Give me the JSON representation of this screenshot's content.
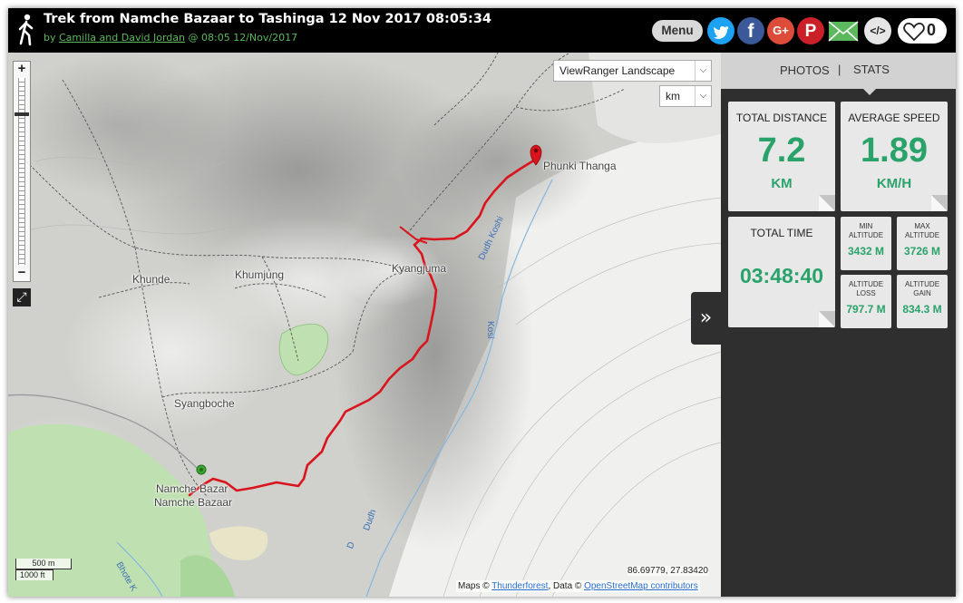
{
  "header": {
    "title": "Trek from Namche Bazaar to Tashinga 12 Nov 2017 08:05:34",
    "by_prefix": "by ",
    "author": "Camilla and David Jordan",
    "time_suffix": " @ 08:05 12/Nov/2017",
    "menu_label": "Menu",
    "like_count": "0",
    "share_icons": [
      "walker-icon",
      "twitter-icon",
      "facebook-icon",
      "google-plus-icon",
      "pinterest-icon",
      "email-icon",
      "embed-icon",
      "heart-icon"
    ],
    "colors": {
      "twitter": "#1da1f2",
      "facebook": "#3b5998",
      "google": "#dd4b39",
      "pinterest": "#cb2027",
      "email": "#5cb85c"
    }
  },
  "map": {
    "layer_select": "ViewRanger Landscape",
    "unit_select": "km",
    "zoom_in": "+",
    "zoom_out": "−",
    "labels": {
      "phunki": "Phunki Thanga",
      "kyangjuma": "Kyangjuma",
      "khunde": "Khunde",
      "khumjung": "Khumjung",
      "syangboche": "Syangboche",
      "namche1": "Namche Bazar",
      "namche2": "Namche Bazaar"
    },
    "rivers": {
      "dudh_koshi": "Dudh Koshi",
      "kosi": "Kosi",
      "dudh": "Dudh",
      "d": "D",
      "bhote": "Bhote K"
    },
    "scale_top": "500 m",
    "scale_bottom": "1000 ft",
    "coords": "86.69779, 27.83420",
    "attribution": {
      "maps_prefix": "Maps © ",
      "maps_link": "Thunderforest",
      "data_prefix": ", Data © ",
      "data_link": "OpenStreetMap contributors"
    },
    "track_color": "#d9141c",
    "start_marker_color": "#3fa535",
    "end_marker_color": "#d9141c"
  },
  "panel": {
    "tab_photos": "PHOTOS",
    "tab_separator": "|",
    "tab_stats": "STATS",
    "toggle_icon": "»",
    "total_distance": {
      "label": "TOTAL DISTANCE",
      "value": "7.2",
      "unit": "KM"
    },
    "average_speed": {
      "label": "AVERAGE SPEED",
      "value": "1.89",
      "unit": "KM/H"
    },
    "total_time": {
      "label": "TOTAL TIME",
      "value": "03:48:40"
    },
    "min_altitude": {
      "label1": "MIN",
      "label2": "ALTITUDE",
      "value": "3432 M"
    },
    "max_altitude": {
      "label1": "MAX",
      "label2": "ALTITUDE",
      "value": "3726 M"
    },
    "altitude_loss": {
      "label1": "ALTITUDE",
      "label2": "LOSS",
      "value": "797.7 M"
    },
    "altitude_gain": {
      "label1": "ALTITUDE",
      "label2": "GAIN",
      "value": "834.3 M"
    },
    "accent_color": "#2aa36a"
  }
}
